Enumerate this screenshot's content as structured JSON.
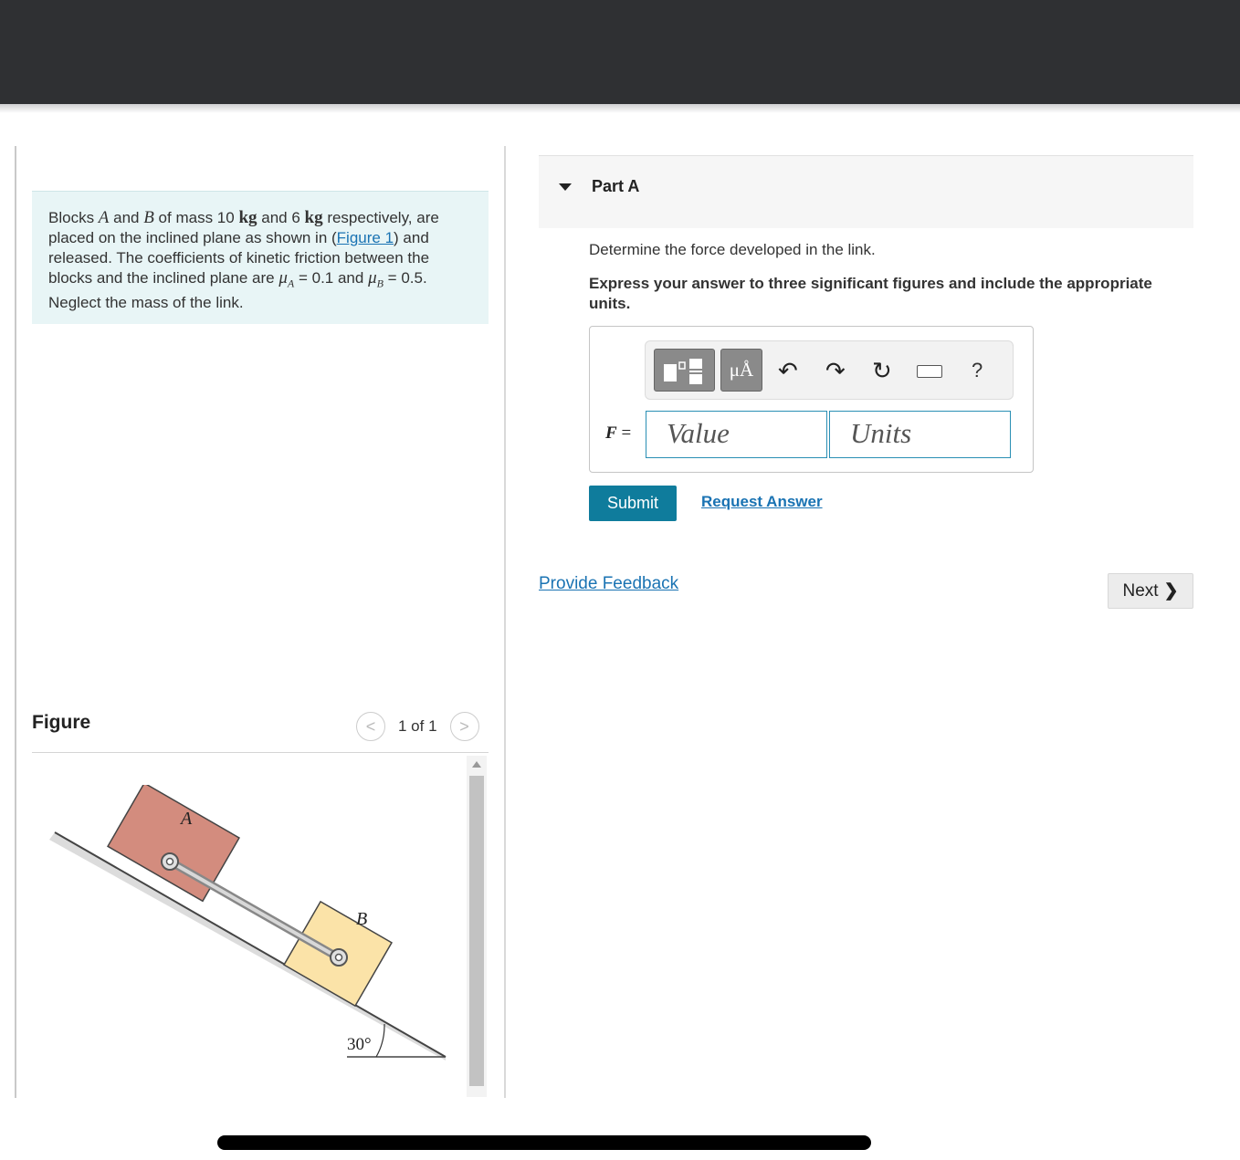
{
  "problem": {
    "t1": "Blocks ",
    "blockA": "A",
    "t2": " and ",
    "blockB": "B",
    "t3": " of mass 10 ",
    "kg1": "kg",
    "t4": " and 6 ",
    "kg2": "kg",
    "t5": " respectively, are placed on the inclined plane as shown in (",
    "figure_link": "Figure 1",
    "t6": ") and released. The coefficients of kinetic friction between the blocks and the inclined plane are ",
    "mu": "μ",
    "subA": "A",
    "t7": " = 0.1 and ",
    "subB": "B",
    "t8": " = 0.5. Neglect the mass of the link."
  },
  "figure_panel": {
    "title": "Figure",
    "prev_icon": "chevron-left-icon",
    "next_icon": "chevron-right-icon",
    "prev_glyph": "<",
    "next_glyph": ">",
    "pager_text": "1 of 1",
    "labels": {
      "a": "A",
      "b": "B",
      "angle": "30°"
    },
    "colors": {
      "block_a": "#d38c7e",
      "block_b": "#fbe3a8",
      "incline": "#d9d9d9"
    }
  },
  "part": {
    "title": "Part A",
    "question": "Determine the force developed in the link.",
    "instruction": "Express your answer to three significant figures and include the appropriate units.",
    "toolbar": {
      "mu_label": "μÅ",
      "undo_glyph": "↶",
      "redo_glyph": "↷",
      "reset_glyph": "↻",
      "help_label": "?"
    },
    "variable": "F",
    "equals": " =",
    "value_placeholder": "Value",
    "units_placeholder": "Units",
    "submit_label": "Submit",
    "request_label": "Request Answer"
  },
  "footer": {
    "feedback_label": "Provide Feedback",
    "next_label": "Next",
    "next_glyph": "❯"
  },
  "colors": {
    "topbar": "#2f3033",
    "accent": "#0f7c9c",
    "link": "#1a73b3",
    "problem_bg": "#e8f5f6"
  }
}
